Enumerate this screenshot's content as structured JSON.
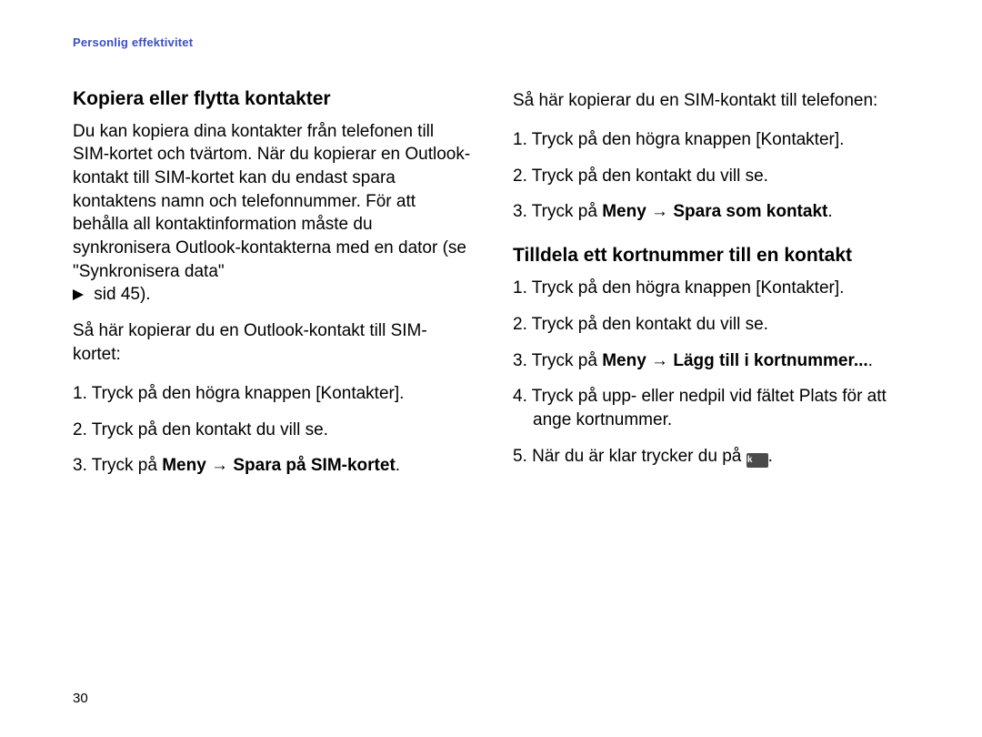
{
  "runningHead": "Personlig effektivitet",
  "pageNumber": "30",
  "left": {
    "heading": "Kopiera eller flytta kontakter",
    "body": "Du kan kopiera dina kontakter från telefonen till SIM-kortet och tvärtom. När du kopierar en Outlook-kontakt till SIM-kortet kan du endast spara kontaktens namn och telefonnummer. För att behålla all kontaktinformation måste du synkronisera Outlook-kontakterna med en dator (se \"Synkronisera data\"",
    "bodyTail": " sid 45).",
    "intro": "Så här kopierar du en Outlook-kontakt till SIM-kortet:",
    "steps": {
      "s1": "Tryck på den högra knappen [Kontakter].",
      "s2": "Tryck på den kontakt du vill se.",
      "s3a": "Tryck på ",
      "s3b": "Meny",
      "s3c": " → ",
      "s3d": "Spara på SIM-kortet",
      "s3e": "."
    }
  },
  "right": {
    "introTop": "Så här kopierar du en SIM-kontakt till telefonen:",
    "stepsTop": {
      "s1": "Tryck på den högra knappen [Kontakter].",
      "s2": "Tryck på den kontakt du vill se.",
      "s3a": "Tryck på ",
      "s3b": "Meny",
      "s3c": " → ",
      "s3d": "Spara som kontakt",
      "s3e": "."
    },
    "heading2": "Tilldela ett kortnummer till en kontakt",
    "stepsBottom": {
      "s1": "Tryck på den högra knappen [Kontakter].",
      "s2": "Tryck på den kontakt du vill se.",
      "s3a": "Tryck på ",
      "s3b": "Meny",
      "s3c": " → ",
      "s3d": "Lägg till i kortnummer...",
      "s3e": ".",
      "s4": "Tryck på upp- eller nedpil vid fältet Plats för att ange kortnummer.",
      "s5a": "När du är klar trycker du på ",
      "s5ok": "ok",
      "s5b": "."
    }
  }
}
